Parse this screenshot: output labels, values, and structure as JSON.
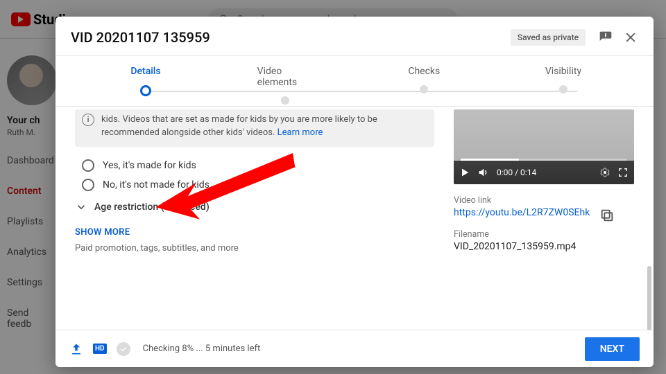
{
  "topbar": {
    "brand": "Studio",
    "search_placeholder": "Search across your channel"
  },
  "sidebar": {
    "channel_title": "Your ch",
    "channel_sub": "Ruth M.",
    "items": [
      "Dashboard",
      "Content",
      "Playlists",
      "Analytics",
      "Settings",
      "Send feedb"
    ]
  },
  "modal": {
    "title": "VID 20201107 135959",
    "saved_chip": "Saved as private",
    "steps": [
      "Details",
      "Video elements",
      "Checks",
      "Visibility"
    ],
    "info_text": "kids. Videos that are set as made for kids by you are more likely to be recommended alongside other kids' videos. ",
    "info_link": "Learn more",
    "radio_yes": "Yes, it's made for kids",
    "radio_no": "No, it's not made for kids",
    "age_row": "Age restriction (advanced)",
    "show_more": "SHOW MORE",
    "show_sub": "Paid promotion, tags, subtitles, and more",
    "preview": {
      "time": "0:00 / 0:14"
    },
    "link_label": "Video link",
    "link_value": "https://youtu.be/L2R7ZW0SEhk",
    "file_label": "Filename",
    "file_value": "VID_20201107_135959.mp4",
    "footer_status": "Checking 8% ... 5 minutes left",
    "next": "NEXT"
  }
}
